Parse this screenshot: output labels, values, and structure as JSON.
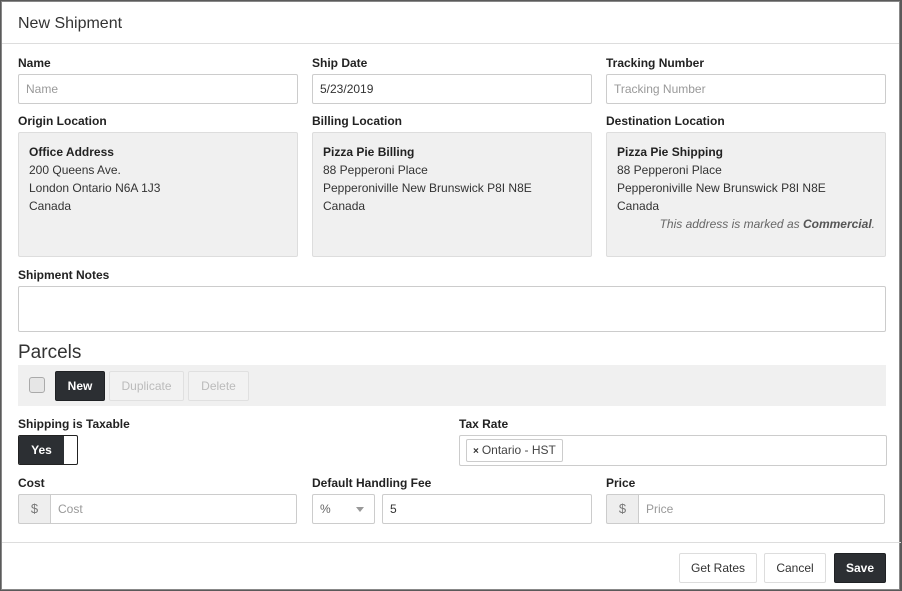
{
  "modal": {
    "title": "New Shipment"
  },
  "fields": {
    "name": {
      "label": "Name",
      "value": "",
      "placeholder": "Name"
    },
    "ship_date": {
      "label": "Ship Date",
      "value": "5/23/2019",
      "placeholder": ""
    },
    "tracking_number": {
      "label": "Tracking Number",
      "value": "",
      "placeholder": "Tracking Number"
    }
  },
  "locations": {
    "origin": {
      "label": "Origin Location",
      "name": "Office Address",
      "line1": "200 Queens Ave.",
      "line2": "London Ontario N6A 1J3",
      "country": "Canada"
    },
    "billing": {
      "label": "Billing Location",
      "name": "Pizza Pie Billing",
      "line1": "88 Pepperoni Place",
      "line2": "Pepperoniville New Brunswick P8I N8E",
      "country": "Canada"
    },
    "destination": {
      "label": "Destination Location",
      "name": "Pizza Pie Shipping",
      "line1": "88 Pepperoni Place",
      "line2": "Pepperoniville New Brunswick P8I N8E",
      "country": "Canada",
      "note_prefix": "This address is marked as ",
      "note_type": "Commercial",
      "note_suffix": "."
    }
  },
  "notes": {
    "label": "Shipment Notes",
    "value": ""
  },
  "parcels": {
    "title": "Parcels",
    "select_all_checked": false,
    "buttons": {
      "new": "New",
      "duplicate": "Duplicate",
      "delete": "Delete"
    }
  },
  "taxable": {
    "label": "Shipping is Taxable",
    "value": "Yes"
  },
  "tax_rate": {
    "label": "Tax Rate",
    "tags": [
      {
        "remove_icon": "×",
        "label": "Ontario - HST"
      }
    ]
  },
  "cost": {
    "label": "Cost",
    "currency": "$",
    "value": "",
    "placeholder": "Cost"
  },
  "handling_fee": {
    "label": "Default Handling Fee",
    "unit": "%",
    "value": "5"
  },
  "price": {
    "label": "Price",
    "currency": "$",
    "value": "",
    "placeholder": "Price"
  },
  "footer": {
    "get_rates": "Get Rates",
    "cancel": "Cancel",
    "save": "Save"
  }
}
